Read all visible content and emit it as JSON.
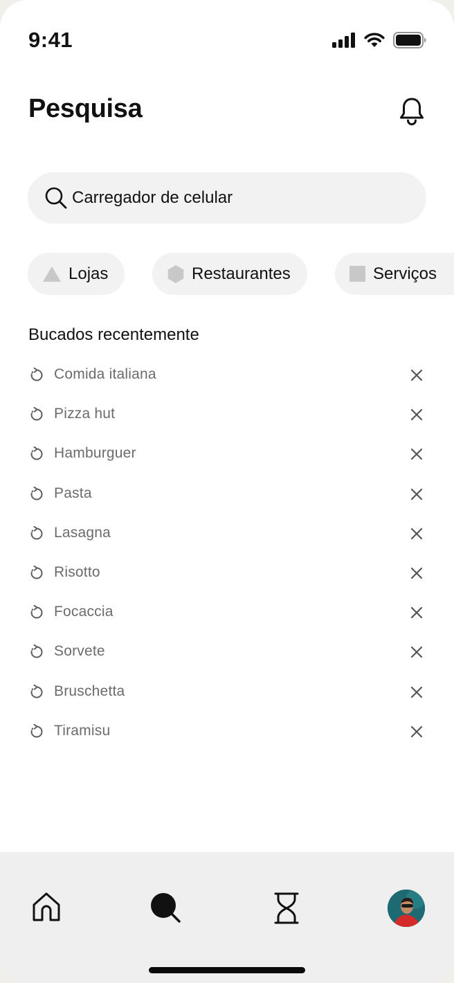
{
  "status_bar": {
    "time": "9:41"
  },
  "header": {
    "title": "Pesquisa"
  },
  "search": {
    "value": "Carregador de celular",
    "placeholder": ""
  },
  "chips": [
    {
      "label": "Lojas",
      "icon": "triangle-icon"
    },
    {
      "label": "Restaurantes",
      "icon": "hexagon-icon"
    },
    {
      "label": "Serviços",
      "icon": "square-icon"
    }
  ],
  "recent": {
    "title": "Bucados recentemente",
    "items": [
      {
        "label": "Comida italiana"
      },
      {
        "label": "Pizza hut"
      },
      {
        "label": "Hamburguer"
      },
      {
        "label": "Pasta"
      },
      {
        "label": "Lasagna"
      },
      {
        "label": "Risotto"
      },
      {
        "label": "Focaccia"
      },
      {
        "label": "Sorvete"
      },
      {
        "label": "Bruschetta"
      },
      {
        "label": "Tiramisu"
      }
    ]
  },
  "bottom_nav": {
    "items": [
      {
        "icon": "home-icon"
      },
      {
        "icon": "search-icon",
        "active": true
      },
      {
        "icon": "hourglass-icon"
      },
      {
        "icon": "avatar"
      }
    ]
  },
  "colors": {
    "background": "#ffffff",
    "surface": "#f2f2f2",
    "nav_background": "#efefef",
    "text_primary": "#111111",
    "text_secondary": "#6b6b6b",
    "chip_icon": "#c8c8c8"
  }
}
